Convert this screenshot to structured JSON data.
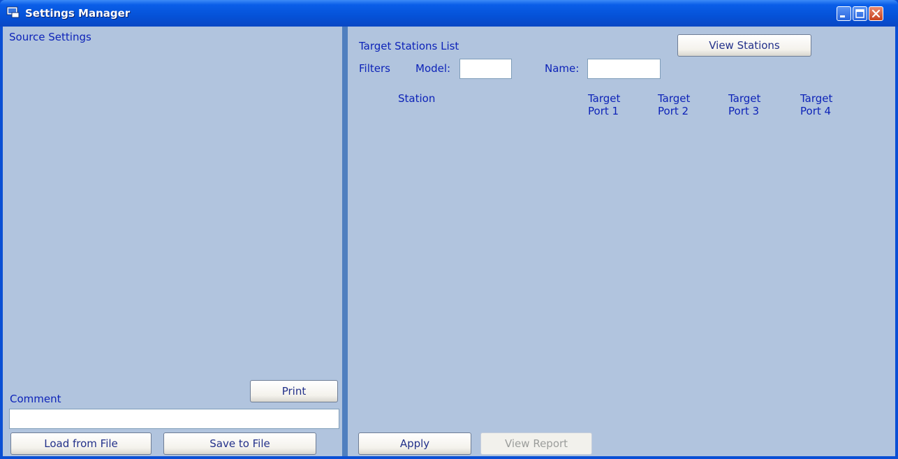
{
  "window": {
    "title": "Settings Manager",
    "controls": [
      "minimize-icon",
      "maximize-icon",
      "close-icon"
    ]
  },
  "left_panel": {
    "heading": "Source Settings",
    "comment_label": "Comment",
    "comment_value": "",
    "print_label": "Print",
    "load_label": "Load from File",
    "save_label": "Save to File"
  },
  "right_panel": {
    "heading": "Target Stations List",
    "view_stations_label": "View Stations",
    "filters_label": "Filters",
    "model_label": "Model:",
    "model_value": "",
    "name_label": "Name:",
    "name_value": "",
    "columns": [
      {
        "line1": "Station",
        "line2": ""
      },
      {
        "line1": "Target",
        "line2": "Port 1"
      },
      {
        "line1": "Target",
        "line2": "Port 2"
      },
      {
        "line1": "Target",
        "line2": "Port 3"
      },
      {
        "line1": "Target",
        "line2": "Port 4"
      }
    ],
    "rows": [],
    "apply_label": "Apply",
    "view_report_label": "View Report"
  },
  "colors": {
    "panel_bg": "#b1c4de",
    "label_text": "#0d23b8",
    "splitter": "#4f7fbf",
    "titlebar": "#0552d8"
  }
}
